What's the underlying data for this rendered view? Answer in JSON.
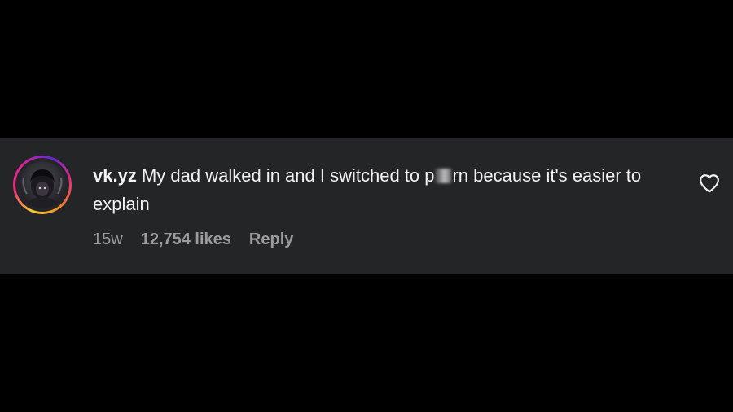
{
  "comment": {
    "username": "vk.yz",
    "text_before_censor": "My dad walked in and I switched to p",
    "text_after_censor": "rn because it's easier to explain",
    "timestamp": "15w",
    "likes": "12,754 likes",
    "reply_label": "Reply"
  },
  "icons": {
    "like": "heart-outline-icon",
    "avatar": "profile-avatar"
  },
  "colors": {
    "background": "#000000",
    "card": "#242527",
    "text": "#f2f2f2",
    "meta": "#9c9c9c"
  }
}
